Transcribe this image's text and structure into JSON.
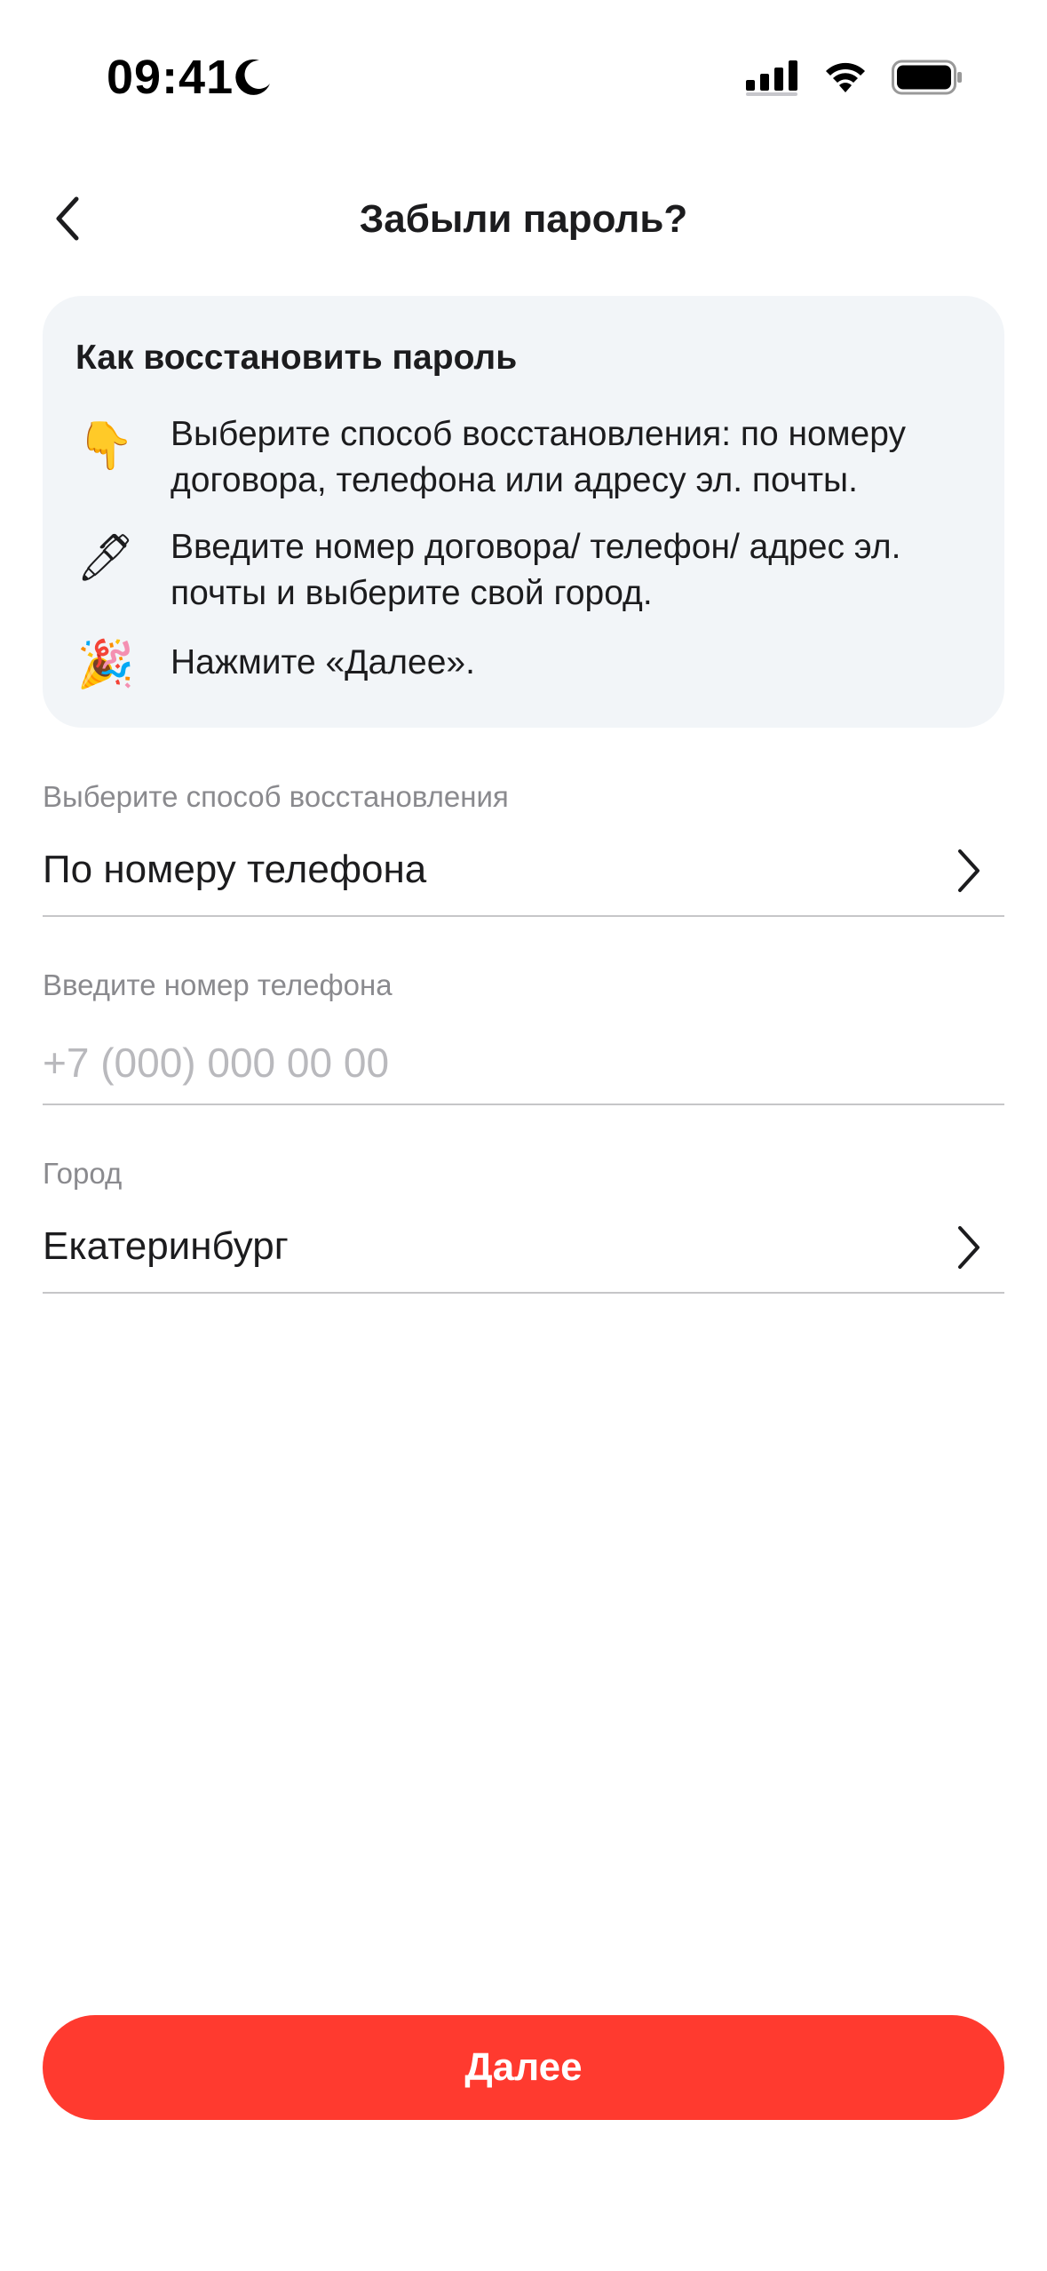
{
  "status_bar": {
    "time": "09:41",
    "icons": [
      "moon-icon",
      "cellular-signal-icon",
      "wifi-icon",
      "battery-icon"
    ]
  },
  "nav": {
    "back_icon": "chevron-left-icon",
    "title": "Забыли пароль?"
  },
  "info_card": {
    "title": "Как восстановить пароль",
    "steps": [
      {
        "emoji": "👇",
        "icon": "pointing-down-hand-icon",
        "text": "Выберите способ восстановления: по номеру договора, телефона или адресу эл. почты."
      },
      {
        "emoji": "🖊",
        "icon": "pen-icon",
        "text": "Введите номер договора/ телефон/ адрес эл. почты и выберите свой город."
      },
      {
        "emoji": "🎉",
        "icon": "party-popper-icon",
        "text": "Нажмите «Далее»."
      }
    ]
  },
  "form": {
    "method": {
      "label": "Выберите способ восстановления",
      "value": "По номеру телефона"
    },
    "phone": {
      "label": "Введите номер телефона",
      "value": "",
      "placeholder": "+7 (000) 000 00 00"
    },
    "city": {
      "label": "Город",
      "value": "Екатеринбург"
    }
  },
  "primary_button": {
    "label": "Далее"
  },
  "colors": {
    "accent": "#ff3a2f",
    "card_background": "#f2f5f8",
    "label_gray": "#8a8a8e",
    "divider": "#c6c6c8"
  }
}
